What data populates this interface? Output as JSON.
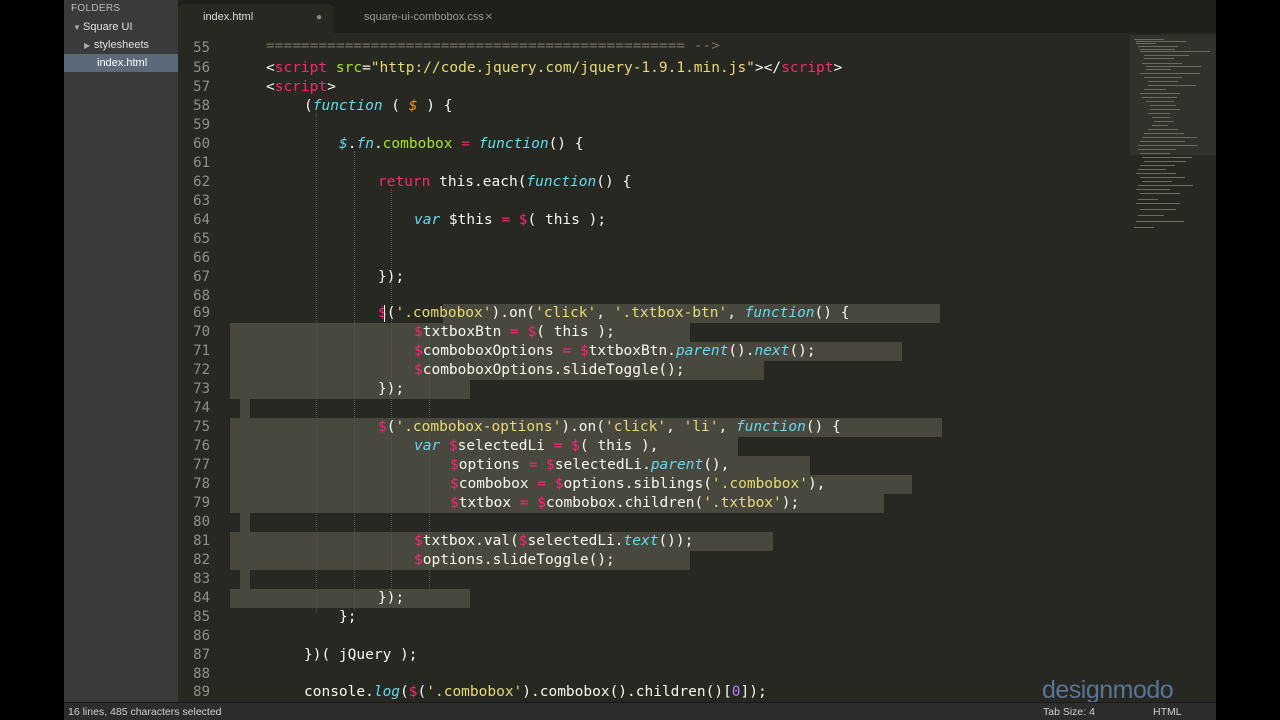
{
  "sidebar": {
    "header": "FOLDERS",
    "items": [
      {
        "label": "Square UI",
        "arrow": "▼"
      },
      {
        "label": "stylesheets",
        "arrow": "▶"
      },
      {
        "label": "index.html",
        "arrow": ""
      }
    ]
  },
  "tabs": [
    {
      "label": "index.html",
      "control": "●"
    },
    {
      "label": "square-ui-combobox.css",
      "control": "✕"
    }
  ],
  "editor": {
    "line_numbers": [
      "55",
      "56",
      "57",
      "58",
      "59",
      "60",
      "61",
      "62",
      "63",
      "64",
      "65",
      "66",
      "67",
      "68",
      "69",
      "70",
      "71",
      "72",
      "73",
      "74",
      "75",
      "76",
      "77",
      "78",
      "79",
      "80",
      "81",
      "82",
      "83",
      "84",
      "85",
      "86",
      "87",
      "88",
      "89"
    ]
  },
  "code": {
    "l55": "================================================ -->",
    "l56_a": "<",
    "l56_b": "script",
    "l56_c": "src",
    "l56_d": "=",
    "l56_e": "\"http://code.jquery.com/jquery-1.9.1.min.js\"",
    "l56_f": "></",
    "l56_g": "script",
    "l56_h": ">",
    "l57_a": "<",
    "l57_b": "script",
    "l57_c": ">",
    "l58_a": "(",
    "l58_b": "function",
    "l58_c": " ( ",
    "l58_d": "$",
    "l58_e": " ) {",
    "l60_a": "$",
    "l60_b": ".",
    "l60_c": "fn",
    "l60_d": ".",
    "l60_e": "combobox",
    "l60_f": " = ",
    "l60_g": "function",
    "l60_h": "() {",
    "l62_a": "return",
    "l62_b": " this.each(",
    "l62_c": "function",
    "l62_d": "() {",
    "l64_a": "var",
    "l64_b": " $this ",
    "l64_c": "=",
    "l64_d": " $",
    "l64_e": "( this );",
    "l67": "});",
    "l69_a": "$",
    "l69_b": "(",
    "l69_c": "'.combobox'",
    "l69_d": ").on(",
    "l69_e": "'click'",
    "l69_f": ", ",
    "l69_g": "'.txtbox-btn'",
    "l69_h": ", ",
    "l69_i": "function",
    "l69_j": "() {",
    "l70_a": "$",
    "l70_b": "txtboxBtn ",
    "l70_c": "=",
    "l70_d": " $",
    "l70_e": "( this );",
    "l71_a": "$",
    "l71_b": "comboboxOptions ",
    "l71_c": "=",
    "l71_d": " $",
    "l71_e": "txtboxBtn.",
    "l71_f": "parent",
    "l71_g": "().",
    "l71_h": "next",
    "l71_i": "();",
    "l72_a": "$",
    "l72_b": "comboboxOptions.slideToggle();",
    "l73": "});",
    "l75_a": "$",
    "l75_b": "(",
    "l75_c": "'.combobox-options'",
    "l75_d": ").on(",
    "l75_e": "'click'",
    "l75_f": ", ",
    "l75_g": "'li'",
    "l75_h": ", ",
    "l75_i": "function",
    "l75_j": "() {",
    "l76_a": "var",
    "l76_b": " $",
    "l76_c": "selectedLi ",
    "l76_d": "=",
    "l76_e": " $",
    "l76_f": "( this ),",
    "l77_a": "$",
    "l77_b": "options ",
    "l77_c": "=",
    "l77_d": " $",
    "l77_e": "selectedLi.",
    "l77_f": "parent",
    "l77_g": "(),",
    "l78_a": "$",
    "l78_b": "combobox ",
    "l78_c": "=",
    "l78_d": " $",
    "l78_e": "options.siblings(",
    "l78_f": "'.combobox'",
    "l78_g": "),",
    "l79_a": "$",
    "l79_b": "txtbox ",
    "l79_c": "=",
    "l79_d": " $",
    "l79_e": "combobox.children(",
    "l79_f": "'.txtbox'",
    "l79_g": ");",
    "l81_a": "$",
    "l81_b": "txtbox.val(",
    "l81_c": "$",
    "l81_d": "selectedLi.",
    "l81_e": "text",
    "l81_f": "());",
    "l82_a": "$",
    "l82_b": "options.slideToggle();",
    "l84": "});",
    "l85": "};",
    "l87": "})( jQuery );",
    "l89_a": "console.",
    "l89_b": "log",
    "l89_c": "(",
    "l89_d": "$",
    "l89_e": "(",
    "l89_f": "'.combobox'",
    "l89_g": ").combobox().children()[",
    "l89_h": "0",
    "l89_i": "]);"
  },
  "status": {
    "selection": "16 lines, 485 characters selected",
    "tab_size": "Tab Size: 4",
    "syntax": "HTML"
  },
  "watermark": "designmodo",
  "colors": {
    "background": "#272822",
    "keyword": "#f92672",
    "string": "#e6db74",
    "function_kw": "#66d9ef",
    "function_name": "#a6e22e",
    "parameter": "#fd971f",
    "selection": "#49483e"
  }
}
